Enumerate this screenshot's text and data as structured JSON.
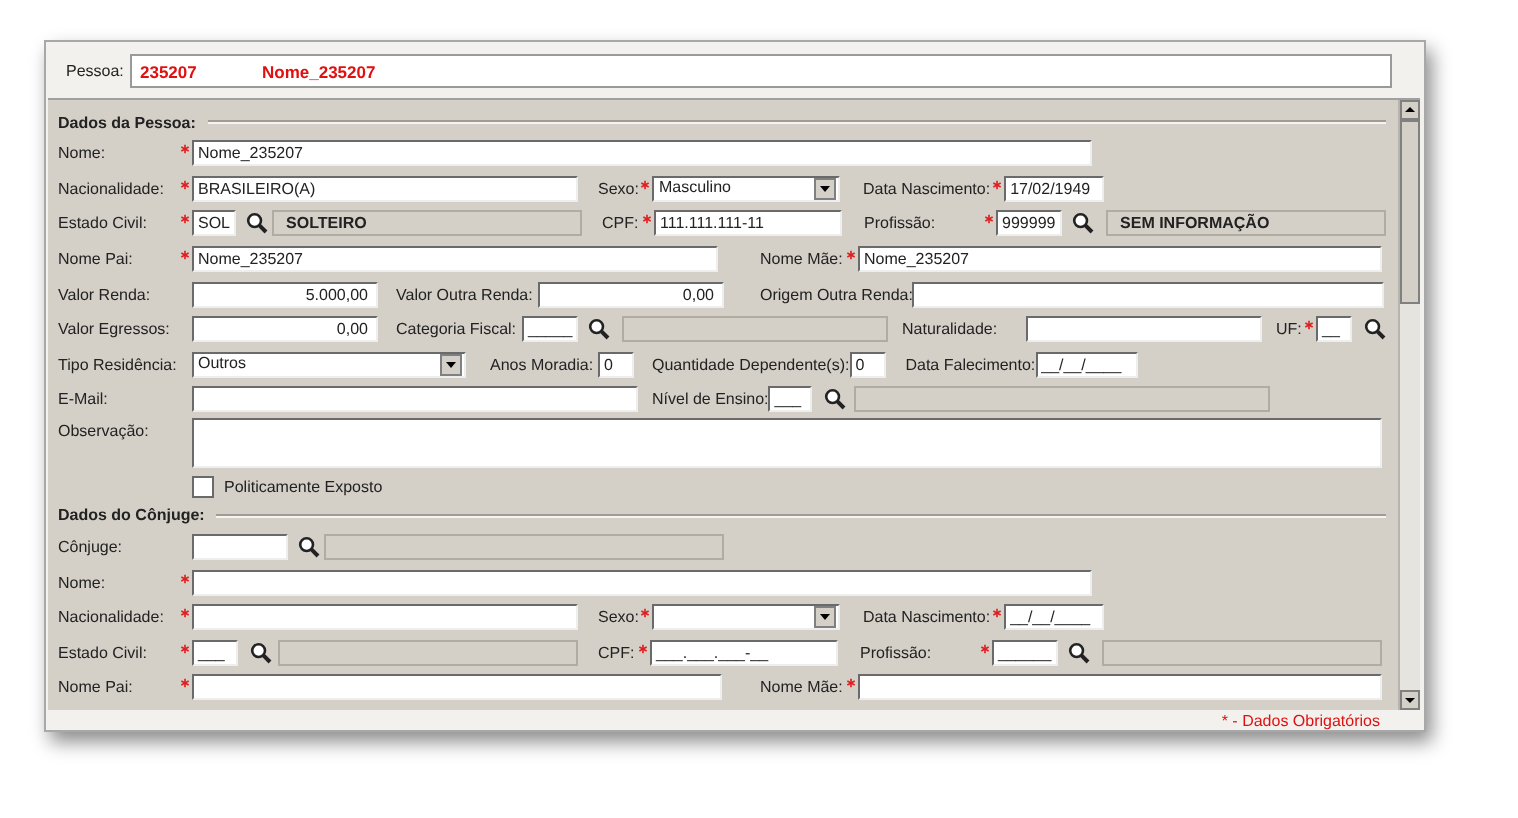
{
  "header": {
    "label": "Pessoa:",
    "code": "235207",
    "name": "Nome_235207"
  },
  "person": {
    "title": "Dados da Pessoa:",
    "nome": {
      "label": "Nome:",
      "required": true,
      "value": "Nome_235207"
    },
    "nacionalidade": {
      "label": "Nacionalidade:",
      "required": true,
      "value": "BRASILEIRO(A)"
    },
    "sexo": {
      "label": "Sexo:",
      "required": true,
      "value": "Masculino"
    },
    "data_nascimento": {
      "label": "Data Nascimento:",
      "required": true,
      "value": "17/02/1949"
    },
    "estado_civil": {
      "label": "Estado Civil:",
      "required": true,
      "value": "SOL",
      "description": "SOLTEIRO"
    },
    "cpf": {
      "label": "CPF:",
      "required": true,
      "value": "111.111.111-11"
    },
    "profissao": {
      "label": "Profissão:",
      "required": true,
      "value": "999999",
      "description": "SEM INFORMAÇÃO"
    },
    "nome_pai": {
      "label": "Nome Pai:",
      "required": true,
      "value": "Nome_235207"
    },
    "nome_mae": {
      "label": "Nome Mãe:",
      "required": true,
      "value": "Nome_235207"
    },
    "valor_renda": {
      "label": "Valor Renda:",
      "required": false,
      "value": "5.000,00"
    },
    "valor_outra_renda": {
      "label": "Valor Outra Renda:",
      "required": false,
      "value": "0,00"
    },
    "origem_outra_renda": {
      "label": "Origem Outra Renda:",
      "required": false
    },
    "valor_egressos": {
      "label": "Valor Egressos:",
      "required": false,
      "value": "0,00"
    },
    "categoria_fiscal": {
      "label": "Categoria Fiscal:",
      "required": false,
      "value": "_____"
    },
    "naturalidade": {
      "label": "Naturalidade:",
      "required": false
    },
    "uf": {
      "label": "UF:",
      "required": true,
      "value": "__"
    },
    "tipo_residencia": {
      "label": "Tipo Residência:",
      "required": false,
      "value": "Outros"
    },
    "anos_moradia": {
      "label": "Anos Moradia:",
      "required": false,
      "value": "0"
    },
    "quantidade_dependentes": {
      "label": "Quantidade Dependente(s):",
      "required": false,
      "value": "0"
    },
    "data_falecimento": {
      "label": "Data Falecimento:",
      "required": false,
      "value": "__/__/____"
    },
    "email": {
      "label": "E-Mail:",
      "required": false
    },
    "nivel_ensino": {
      "label": "Nível de Ensino:",
      "required": false,
      "value": "___"
    },
    "observacao": {
      "label": "Observação:",
      "required": false
    },
    "politicamente_exposto": {
      "label": "Politicamente Exposto",
      "checked": false
    }
  },
  "spouse": {
    "title": "Dados do Cônjuge:",
    "conjuge": {
      "label": "Cônjuge:",
      "required": false
    },
    "nome": {
      "label": "Nome:",
      "required": true
    },
    "nacionalidade": {
      "label": "Nacionalidade:",
      "required": true
    },
    "sexo": {
      "label": "Sexo:",
      "required": true
    },
    "data_nascimento": {
      "label": "Data Nascimento:",
      "required": true,
      "value": "__/__/____"
    },
    "estado_civil": {
      "label": "Estado Civil:",
      "required": true,
      "value": "___"
    },
    "cpf": {
      "label": "CPF:",
      "required": true,
      "value": "___.___.___-__"
    },
    "profissao": {
      "label": "Profissão:",
      "required": true,
      "value": "______"
    },
    "nome_pai": {
      "label": "Nome Pai:",
      "required": true
    },
    "nome_mae": {
      "label": "Nome Mãe:",
      "required": true
    }
  },
  "footer": "* - Dados Obrigatórios"
}
